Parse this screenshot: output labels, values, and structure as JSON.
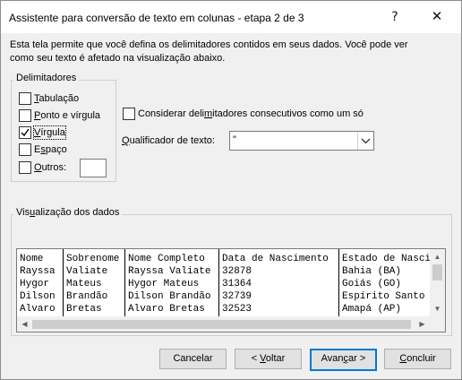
{
  "window": {
    "title": "Assistente para conversão de texto em colunas - etapa 2 de 3",
    "help_label": "?",
    "close_label": "✕"
  },
  "description_line1": "Esta tela permite que você defina os delimitadores contidos em seus dados. Você pode ver",
  "description_line2": "como seu texto é afetado na visualização abaixo.",
  "delimiters": {
    "legend": "Delimitadores",
    "tab": {
      "pre": "",
      "key": "T",
      "post": "abulação",
      "checked": false
    },
    "semicolon": {
      "pre": "",
      "key": "P",
      "post": "onto e vírgula",
      "checked": false
    },
    "comma": {
      "pre": "",
      "key": "V",
      "post": "írgula",
      "checked": true
    },
    "space": {
      "pre": "E",
      "key": "s",
      "post": "paço",
      "checked": false
    },
    "other": {
      "pre": "",
      "key": "O",
      "post": "utros:",
      "checked": false
    },
    "other_value": ""
  },
  "consecutive": {
    "pre": "Considerar deli",
    "key": "m",
    "post": "itadores consecutivos como um só",
    "checked": false
  },
  "qualifier": {
    "pre": "",
    "key": "Q",
    "post": "ualificador de texto:",
    "value": "\""
  },
  "preview": {
    "legend_pre": "Vis",
    "legend_key": "u",
    "legend_post": "alização dos dados",
    "columns": [
      [
        "Nome",
        "Rayssa",
        "Hygor",
        "Dilson",
        "Alvaro"
      ],
      [
        "Sobrenome",
        "Valiate",
        "Mateus",
        "Brandão",
        "Bretas"
      ],
      [
        "Nome Completo",
        "Rayssa Valiate",
        "Hygor Mateus",
        "Dilson Brandão",
        "Alvaro Bretas"
      ],
      [
        "Data de Nascimento",
        "32878",
        "31364",
        "32739",
        "32523"
      ],
      [
        "Estado de Nascimento",
        "Bahia (BA)",
        "Goiás (GO)",
        "Espírito Santo",
        "Amapá (AP)"
      ]
    ]
  },
  "buttons": {
    "cancel": "Cancelar",
    "back": {
      "pre": "< ",
      "key": "V",
      "post": "oltar"
    },
    "next": {
      "pre": "Avan",
      "key": "ç",
      "post": "ar >"
    },
    "finish": {
      "pre": "",
      "key": "C",
      "post": "oncluir"
    }
  },
  "colors": {
    "accent": "#0078d7",
    "dialog_bg": "#f0f0f0"
  }
}
